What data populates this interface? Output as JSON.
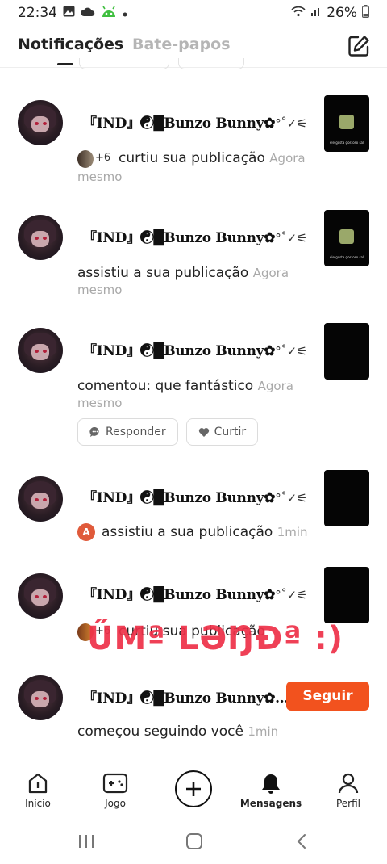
{
  "status_bar": {
    "time": "22:34",
    "battery": "26%",
    "icons": [
      "gallery-icon",
      "cloud-icon",
      "android-icon",
      "dot-icon",
      "wifi-icon",
      "signal-icon",
      "battery-icon"
    ]
  },
  "header": {
    "tabs": [
      {
        "label": "Notificações",
        "active": true
      },
      {
        "label": "Bate-papos",
        "active": false
      }
    ],
    "compose_icon": "compose-icon"
  },
  "notifications": [
    {
      "username": "『IND』☯█Bunzo Bunny✿",
      "username_trail": "°˚✓⚟",
      "stack_count": "+6",
      "action": "curtiu sua publicação",
      "time_part1": "Agora",
      "time_part2": "mesmo",
      "thumb_caption": "ele gosta gostoso sal"
    },
    {
      "username": "『IND』☯█Bunzo Bunny✿",
      "username_trail": "°˚✓⚟",
      "action": "assistiu a sua publicação",
      "time_part1": "Agora",
      "time_part2": "mesmo",
      "thumb_caption": "ele gosta gostoso sal"
    },
    {
      "username": "『IND』☯█Bunzo Bunny✿",
      "username_trail": "°˚✓⚟",
      "action": "comentou: que fantástico",
      "time_part1": "Agora",
      "time_part2": "mesmo",
      "reply_label": "Responder",
      "like_label": "Curtir"
    },
    {
      "username": "『IND』☯█Bunzo Bunny✿",
      "username_trail": "°˚✓⚟",
      "badge": "A",
      "action": "assistiu a sua publicação",
      "time": "1min"
    },
    {
      "username": "『IND』☯█Bunzo Bunny✿",
      "username_trail": "°˚✓⚟",
      "stack_count": "+6",
      "action": "curtiu sua publicação",
      "watermark": "ŰMª LƏŊƉª :)"
    },
    {
      "username": "『IND』☯█Bunzo Bunny✿...",
      "follow_label": "Seguir",
      "action": "começou seguindo você",
      "time": "1min"
    }
  ],
  "bottom_nav": [
    {
      "label": "Início",
      "icon": "home-icon",
      "active": false
    },
    {
      "label": "Jogo",
      "icon": "gamepad-icon",
      "active": false
    },
    {
      "label": "",
      "icon": "plus-icon",
      "active": false
    },
    {
      "label": "Mensagens",
      "icon": "bell-icon",
      "active": true
    },
    {
      "label": "Perfil",
      "icon": "person-icon",
      "active": false
    }
  ],
  "system_nav": [
    "recents-icon",
    "home-button-icon",
    "back-icon"
  ],
  "colors": {
    "accent": "#f2521e",
    "watermark": "#ee3048",
    "inactive_tab": "#b5b5b5",
    "muted_text": "#a9a9a9"
  }
}
